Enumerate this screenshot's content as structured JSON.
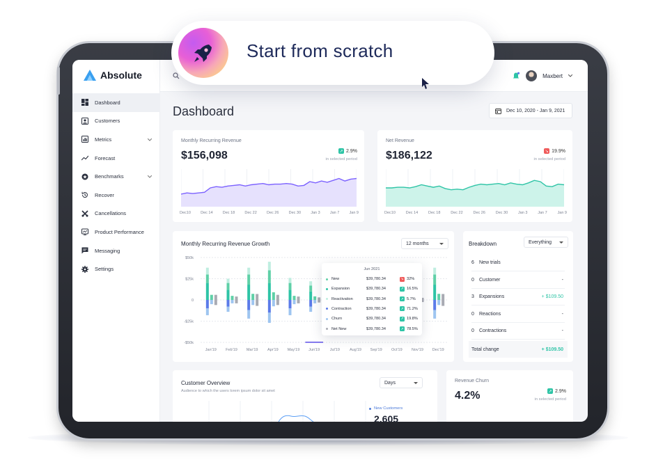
{
  "hero": {
    "text": "Start from scratch"
  },
  "brand": {
    "name": "Absolute"
  },
  "user": {
    "name": "Maxbert"
  },
  "nav": [
    {
      "label": "Dashboard",
      "icon": "dashboard-icon",
      "active": true
    },
    {
      "label": "Customers",
      "icon": "customers-icon"
    },
    {
      "label": "Metrics",
      "icon": "metrics-icon",
      "has_children": true
    },
    {
      "label": "Forecast",
      "icon": "forecast-icon"
    },
    {
      "label": "Benchmarks",
      "icon": "benchmarks-icon",
      "has_children": true
    },
    {
      "label": "Recover",
      "icon": "recover-icon"
    },
    {
      "label": "Cancellations",
      "icon": "cancellations-icon"
    },
    {
      "label": "Product Performance",
      "icon": "product-performance-icon"
    },
    {
      "label": "Messaging",
      "icon": "messaging-icon"
    },
    {
      "label": "Settings",
      "icon": "settings-icon"
    }
  ],
  "page": {
    "title": "Dashboard",
    "date_range": "Dec 10, 2020 - Jan 9, 2021"
  },
  "mrr": {
    "title": "Monthly Recurring Revenue",
    "value": "$156,098",
    "delta": "2.9%",
    "delta_sub": "in selected period",
    "color": "#7b61ff"
  },
  "net_revenue": {
    "title": "Net Revenue",
    "value": "$186,122",
    "delta": "19.9%",
    "delta_sub": "in selected period",
    "color": "#2ec4a6"
  },
  "growth": {
    "title": "Monthly Recurring Revenue Growth",
    "period": "12 months",
    "tooltip": {
      "header": "Jun 2021",
      "rows": [
        {
          "label": "New",
          "amount": "$39,780.34",
          "pct": "32%",
          "trend": "down",
          "color": "#5fd0a7"
        },
        {
          "label": "Expansion",
          "amount": "$39,780.34",
          "pct": "16.5%",
          "trend": "up",
          "color": "#2ec4a6"
        },
        {
          "label": "Reactivation",
          "amount": "$39,780.34",
          "pct": "5.7%",
          "trend": "up",
          "color": "#bfeee0"
        },
        {
          "label": "Contraction",
          "amount": "$39,780.34",
          "pct": "71.2%",
          "trend": "up",
          "color": "#5b7be9"
        },
        {
          "label": "Churn",
          "amount": "$39,780.34",
          "pct": "19.8%",
          "trend": "up",
          "color": "#9ec5f0"
        },
        {
          "label": "Net New",
          "amount": "$39,780.34",
          "pct": "78.5%",
          "trend": "up",
          "color": "#a9abb3"
        }
      ]
    }
  },
  "breakdown": {
    "title": "Breakdown",
    "filter": "Everything",
    "rows": [
      {
        "n": "6",
        "label": "New trials",
        "value": ""
      },
      {
        "n": "0",
        "label": "Customer",
        "value": "-"
      },
      {
        "n": "3",
        "label": "Expansions",
        "value": "+ $109.50"
      },
      {
        "n": "0",
        "label": "Reactions",
        "value": "-"
      },
      {
        "n": "0",
        "label": "Contractions",
        "value": "-"
      }
    ],
    "total_label": "Total change",
    "total_value": "+ $109.50"
  },
  "customer_overview": {
    "title": "Customer Overview",
    "subtitle": "Audience to which the users lorem ipsum dolor sit amet",
    "period": "Days",
    "legend_label": "New Customers",
    "legend_value": "2,605"
  },
  "revenue_churn": {
    "title": "Revenue Churn",
    "value": "4.2%",
    "delta": "2.9%",
    "delta_sub": "in selected period"
  },
  "chart_data": [
    {
      "type": "area",
      "title": "Monthly Recurring Revenue",
      "categories": [
        "Dec10",
        "Dec 14",
        "Dec 18",
        "Dec 22",
        "Dec 26",
        "Dec 30",
        "Jan 3",
        "Jan 7",
        "Jan 9"
      ],
      "x": [
        0,
        1,
        2,
        3,
        4,
        5,
        6,
        7,
        8,
        9,
        10,
        11,
        12,
        13,
        14,
        15,
        16,
        17,
        18,
        19,
        20,
        21,
        22,
        23,
        24,
        25,
        26,
        27,
        28,
        29,
        30
      ],
      "series": [
        {
          "values": [
            20,
            22,
            21,
            22,
            23,
            30,
            32,
            31,
            33,
            34,
            35,
            33,
            35,
            36,
            37,
            35,
            36,
            36,
            37,
            36,
            33,
            34,
            40,
            38,
            41,
            39,
            42,
            45,
            41,
            44,
            45
          ]
        }
      ],
      "ylim": [
        0,
        60
      ]
    },
    {
      "type": "area",
      "title": "Net Revenue",
      "categories": [
        "Dec10",
        "Dec 14",
        "Dec 18",
        "Dec 22",
        "Dec 26",
        "Dec 30",
        "Jan 3",
        "Jan 7",
        "Jan 9"
      ],
      "x": [
        0,
        1,
        2,
        3,
        4,
        5,
        6,
        7,
        8,
        9,
        10,
        11,
        12,
        13,
        14,
        15,
        16,
        17,
        18,
        19,
        20,
        21,
        22,
        23,
        24,
        25,
        26,
        27,
        28,
        29,
        30
      ],
      "series": [
        {
          "values": [
            30,
            30,
            31,
            31,
            30,
            32,
            35,
            33,
            31,
            33,
            29,
            27,
            28,
            27,
            31,
            34,
            36,
            35,
            36,
            37,
            35,
            38,
            36,
            35,
            38,
            42,
            40,
            33,
            32,
            36,
            35
          ]
        }
      ],
      "ylim": [
        0,
        60
      ]
    },
    {
      "type": "bar",
      "title": "Monthly Recurring Revenue Growth",
      "categories": [
        "Jan'19",
        "Feb'19",
        "Mar'19",
        "Apr'19",
        "May'19",
        "Jun'19",
        "Jul'19",
        "Aug'19",
        "Sep'19",
        "Oct'19",
        "Nov'19",
        "Dec'19"
      ],
      "yticks": [
        "$50k",
        "$25k",
        "0",
        "-$25k",
        "-$50k"
      ],
      "ylim": [
        -50,
        50
      ],
      "series": [
        {
          "name": "New",
          "values": [
            20,
            12,
            18,
            20,
            12,
            10,
            8,
            10,
            9,
            10,
            8,
            18
          ]
        },
        {
          "name": "Expansion",
          "values": [
            10,
            8,
            12,
            15,
            8,
            7,
            6,
            8,
            7,
            6,
            6,
            12
          ]
        },
        {
          "name": "Reactivation",
          "values": [
            8,
            5,
            8,
            10,
            6,
            5,
            5,
            6,
            5,
            5,
            4,
            8
          ]
        },
        {
          "name": "Contraction",
          "values": [
            -10,
            -8,
            -12,
            -15,
            -10,
            -8,
            -6,
            -8,
            -7,
            -6,
            -6,
            -12
          ]
        },
        {
          "name": "Churn",
          "values": [
            -8,
            -6,
            -10,
            -12,
            -8,
            -6,
            -5,
            -6,
            -5,
            -5,
            -4,
            -10
          ]
        },
        {
          "name": "Net New",
          "values": [
            12,
            8,
            14,
            12,
            8,
            6,
            5,
            8,
            6,
            6,
            5,
            14
          ]
        }
      ]
    }
  ]
}
